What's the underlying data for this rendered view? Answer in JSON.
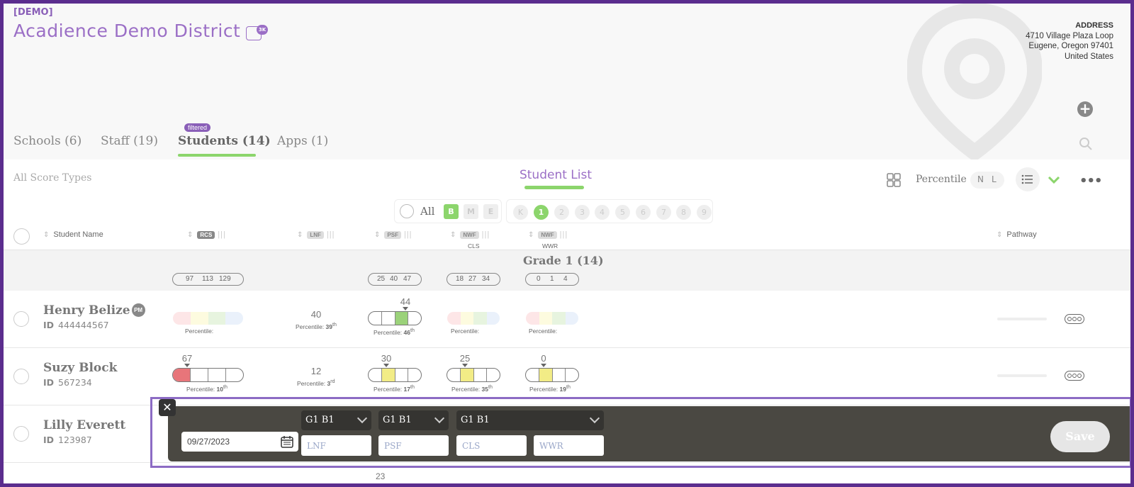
{
  "header": {
    "demo_tag": "[DEMO]",
    "district_name": "Acadience Demo District",
    "badge_text": "3K",
    "address": {
      "title": "ADDRESS",
      "line1": "4710 Village Plaza Loop",
      "line2": "Eugene, Oregon 97401",
      "line3": "United States"
    }
  },
  "tabs": {
    "schools": "Schools (6)",
    "staff": "Staff (19)",
    "students": "Students (14)",
    "apps": "Apps (1)",
    "filtered_badge": "filtered"
  },
  "toolbar": {
    "score_types": "All Score Types",
    "list_title": "Student List",
    "percentile_label": "Percentile",
    "toggle_n": "N",
    "toggle_l": "L",
    "more": "•••"
  },
  "filter": {
    "all_label": "All",
    "periods": [
      "B",
      "M",
      "E"
    ],
    "grades": [
      "K",
      "1",
      "2",
      "3",
      "4",
      "5",
      "6",
      "7",
      "8",
      "9"
    ],
    "active_grade": "1"
  },
  "columns": {
    "student_name": "Student Name",
    "rcs": "RCS",
    "lnf": "LNF",
    "psf": "PSF",
    "nwf_cls": "NWF",
    "nwf_cls_sub": "CLS",
    "nwf_wwr": "NWF",
    "nwf_wwr_sub": "WWR",
    "pathway": "Pathway"
  },
  "grade_group": {
    "title": "Grade 1 (14)",
    "rcs_bench": [
      "97",
      "113",
      "129"
    ],
    "psf_bench": [
      "25",
      "40",
      "47"
    ],
    "cls_bench": [
      "18",
      "27",
      "34"
    ],
    "wwr_bench": [
      "0",
      "1",
      "4"
    ]
  },
  "students": [
    {
      "name": "Henry Belize",
      "pm_badge": "PM",
      "id_label": "ID",
      "id": "444444567",
      "lnf": "40",
      "lnf_pct_label": "Percentile:",
      "lnf_pct": "39",
      "psf": "44",
      "psf_pct_label": "Percentile:",
      "psf_pct": "46",
      "rcs_pct_label": "Percentile:",
      "cls_pct_label": "Percentile:",
      "wwr_pct_label": "Percentile:"
    },
    {
      "name": "Suzy Block",
      "id_label": "ID",
      "id": "567234",
      "rcs": "67",
      "rcs_pct_label": "Percentile:",
      "rcs_pct": "10",
      "lnf": "12",
      "lnf_pct_label": "Percentile:",
      "lnf_pct": "3",
      "psf": "30",
      "psf_pct_label": "Percentile:",
      "psf_pct": "17",
      "cls": "25",
      "cls_pct_label": "Percentile:",
      "cls_pct": "35",
      "wwr": "0",
      "wwr_pct_label": "Percentile:",
      "wwr_pct": "19"
    },
    {
      "name": "Lilly Everett",
      "id_label": "ID",
      "id": "123987"
    }
  ],
  "entry": {
    "date": "09/27/2023",
    "period_select_1": "G1 B1",
    "period_select_2": "G1 B1",
    "period_select_3": "G1 B1",
    "lnf_placeholder": "LNF",
    "psf_placeholder": "PSF",
    "cls_placeholder": "CLS",
    "wwr_placeholder": "WWR",
    "save_label": "Save"
  },
  "bottom_peek_value": "23",
  "colors": {
    "brand_purple": "#9b6fc6",
    "accent_green": "#8cd56c",
    "frame": "#5b2d8e",
    "red": "#e8757a",
    "yellow": "#f2ec86",
    "green": "#9bd27a",
    "blue": "#c8def5"
  }
}
